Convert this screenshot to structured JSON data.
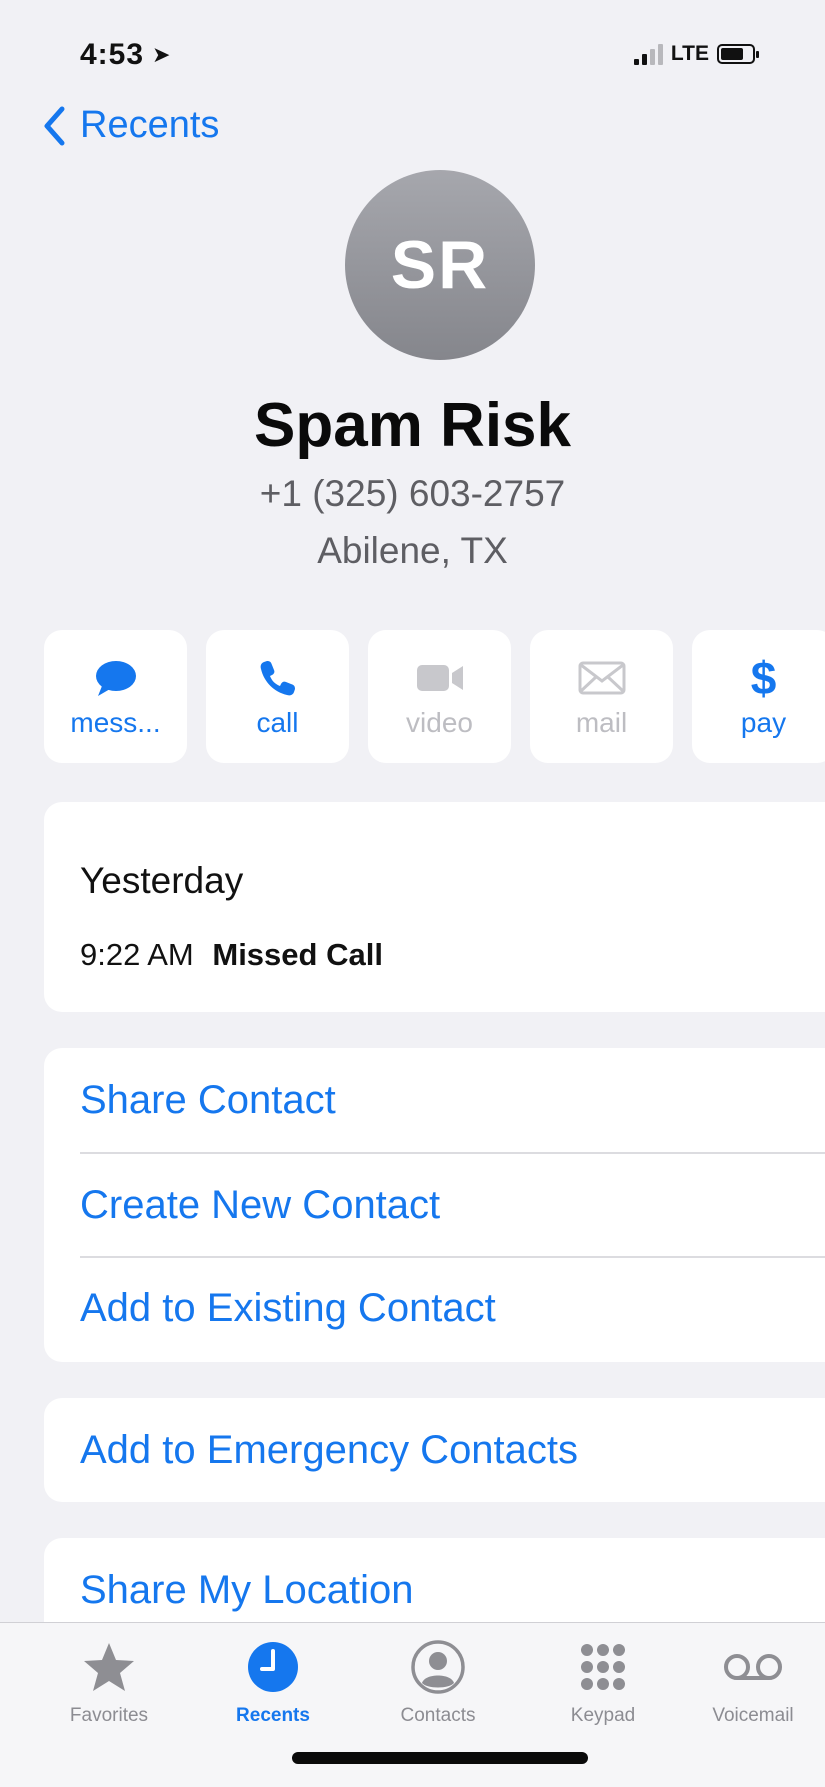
{
  "status_bar": {
    "time": "4:53",
    "network": "LTE"
  },
  "nav": {
    "back_label": "Recents"
  },
  "contact": {
    "initials": "SR",
    "name": "Spam Risk",
    "phone": "+1 (325) 603-2757",
    "location": "Abilene, TX"
  },
  "actions": [
    {
      "label": "mess...",
      "icon": "message-icon",
      "enabled": true
    },
    {
      "label": "call",
      "icon": "phone-icon",
      "enabled": true
    },
    {
      "label": "video",
      "icon": "video-icon",
      "enabled": false
    },
    {
      "label": "mail",
      "icon": "mail-icon",
      "enabled": false
    },
    {
      "label": "pay",
      "icon": "dollar-icon",
      "enabled": true
    }
  ],
  "recent_call": {
    "day": "Yesterday",
    "time": "9:22 AM",
    "status": "Missed Call"
  },
  "menu": {
    "share_contact": "Share Contact",
    "create_new_contact": "Create New Contact",
    "add_to_existing_contact": "Add to Existing Contact",
    "add_to_emergency_contacts": "Add to Emergency Contacts",
    "share_my_location": "Share My Location"
  },
  "tabs": [
    {
      "label": "Favorites",
      "icon": "star-icon",
      "active": false
    },
    {
      "label": "Recents",
      "icon": "clock-icon",
      "active": true
    },
    {
      "label": "Contacts",
      "icon": "person-circle-icon",
      "active": false
    },
    {
      "label": "Keypad",
      "icon": "keypad-icon",
      "active": false
    },
    {
      "label": "Voicemail",
      "icon": "voicemail-icon",
      "active": false
    }
  ],
  "colors": {
    "accent": "#1577ee",
    "disabled": "#bdbdc2",
    "background": "#f1f1f5",
    "avatar": "#96979d"
  }
}
